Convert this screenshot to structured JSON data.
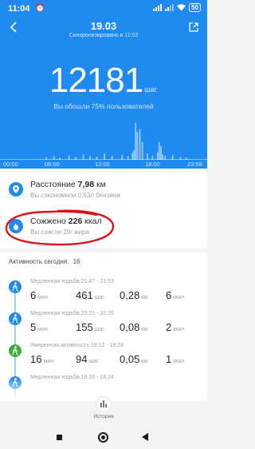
{
  "status_bar": {
    "time": "11:04",
    "battery": "50"
  },
  "header": {
    "date": "19.03",
    "sync": "Синхронизировано в 11:02",
    "steps": "12181",
    "steps_unit": "шаг.",
    "caption": "Вы обошли 75% пользователей"
  },
  "time_axis": [
    "00:00",
    "06:00",
    "12:00",
    "18:00",
    "23:59"
  ],
  "chart_data": {
    "type": "bar",
    "x_range": [
      0,
      24
    ],
    "ylim": [
      0,
      100
    ],
    "x": [
      5.2,
      6.1,
      6.8,
      7.9,
      8.7,
      9.6,
      10.4,
      11.2,
      12.1,
      13.0,
      14.2,
      14.9,
      15.4,
      15.6,
      15.8,
      16.0,
      16.3,
      16.6,
      17.2,
      17.8,
      18.4,
      18.6,
      18.8,
      19.0,
      19.3,
      20.2,
      21.1,
      21.8
    ],
    "values": [
      6,
      8,
      5,
      10,
      6,
      12,
      8,
      7,
      14,
      9,
      11,
      8,
      15,
      22,
      82,
      62,
      68,
      40,
      14,
      9,
      16,
      40,
      30,
      12,
      9,
      11,
      6,
      5
    ],
    "grid": false
  },
  "summary": {
    "distance": {
      "label": "Расстояние",
      "value": "7,98",
      "unit": "км",
      "sub": "Вы сэкономили 0,63л бензина"
    },
    "burned": {
      "label": "Сожжено",
      "value": "226",
      "unit": "ккал",
      "sub": "Вы сожгли 29г жира"
    }
  },
  "activities": {
    "title": "Активность сегодня:",
    "count": "16",
    "items": [
      {
        "title": "Медленная ходьба 21:47 - 21:53",
        "minutes": "6",
        "minutes_unit": "мин",
        "steps": "461",
        "steps_unit": "шаг.",
        "km": "0,28",
        "km_unit": "км",
        "kcal": "6",
        "kcal_unit": "ккал",
        "color": "#1f8af0"
      },
      {
        "title": "Медленная ходьба 20:21 - 20:26",
        "minutes": "5",
        "minutes_unit": "мин",
        "steps": "155",
        "steps_unit": "шаг.",
        "km": "0,08",
        "km_unit": "км",
        "kcal": "2",
        "kcal_unit": "ккал",
        "color": "#1f8af0"
      },
      {
        "title": "Умеренная активность 19:12 - 19:28",
        "minutes": "16",
        "minutes_unit": "мин",
        "steps": "94",
        "steps_unit": "шаг.",
        "km": "0,05",
        "km_unit": "км",
        "kcal": "1",
        "kcal_unit": "ккал",
        "color": "#3fae3a"
      },
      {
        "title": "Медленная ходьба 18:20 - 18:24",
        "minutes": "",
        "minutes_unit": "",
        "steps": "",
        "steps_unit": "",
        "km": "",
        "km_unit": "",
        "kcal": "",
        "kcal_unit": "",
        "color": "#1f8af0"
      }
    ]
  },
  "history": {
    "label": "История",
    "icon": "bar-chart-icon"
  },
  "colors": {
    "primary": "#1f8af0",
    "highlight": "#d7141a",
    "moderate": "#3fae3a"
  }
}
